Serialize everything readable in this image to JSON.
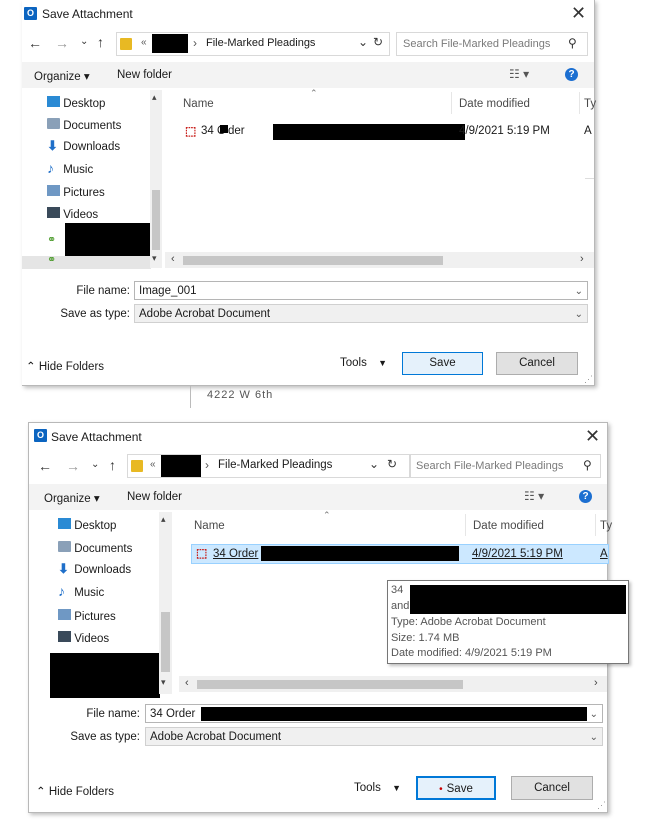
{
  "dialog1": {
    "title": "Save Attachment",
    "address": {
      "chevron": "«",
      "separator": "›",
      "folder": "File-Marked Pleadings"
    },
    "search_placeholder": "Search File-Marked Pleadings",
    "toolbar": {
      "organize": "Organize ▾",
      "new_folder": "New folder",
      "help": "?"
    },
    "sidebar": [
      {
        "label": "Desktop",
        "icon": "desktop-icon"
      },
      {
        "label": "Documents",
        "icon": "documents-icon"
      },
      {
        "label": "Downloads",
        "icon": "downloads-icon"
      },
      {
        "label": "Music",
        "icon": "music-icon"
      },
      {
        "label": "Pictures",
        "icon": "pictures-icon"
      },
      {
        "label": "Videos",
        "icon": "videos-icon"
      }
    ],
    "columns": {
      "name": "Name",
      "date": "Date modified",
      "type": "Ty"
    },
    "row": {
      "name_prefix": "34 O",
      "name_mid": "der",
      "date": "4/9/2021 5:19 PM",
      "type": "A"
    },
    "file_name_label": "File name:",
    "file_name_value": "Image_001",
    "save_type_label": "Save as type:",
    "save_type_value": "Adobe Acrobat Document",
    "hide_folders": "Hide Folders",
    "tools": "Tools",
    "save": "Save",
    "cancel": "Cancel"
  },
  "between_text": {
    "line1": "4222 W 6th"
  },
  "dialog2": {
    "title": "Save Attachment",
    "address": {
      "chevron": "«",
      "separator": "›",
      "folder": "File-Marked Pleadings"
    },
    "search_placeholder": "Search File-Marked Pleadings",
    "toolbar": {
      "organize": "Organize ▾",
      "new_folder": "New folder",
      "help": "?"
    },
    "sidebar": [
      {
        "label": "Desktop",
        "icon": "desktop-icon"
      },
      {
        "label": "Documents",
        "icon": "documents-icon"
      },
      {
        "label": "Downloads",
        "icon": "downloads-icon"
      },
      {
        "label": "Music",
        "icon": "music-icon"
      },
      {
        "label": "Pictures",
        "icon": "pictures-icon"
      },
      {
        "label": "Videos",
        "icon": "videos-icon"
      }
    ],
    "columns": {
      "name": "Name",
      "date": "Date modified",
      "type": "Ty"
    },
    "row": {
      "name_prefix": "34 Order",
      "date": "4/9/2021 5:19 PM",
      "type": "A"
    },
    "tooltip": {
      "line1": "34",
      "line2": "and",
      "type": "Type: Adobe Acrobat Document",
      "size": "Size: 1.74 MB",
      "date": "Date modified: 4/9/2021 5:19 PM"
    },
    "file_name_label": "File name:",
    "file_name_value": "34 Order",
    "save_type_label": "Save as type:",
    "save_type_value": "Adobe Acrobat Document",
    "hide_folders": "Hide Folders",
    "tools": "Tools",
    "save": "Save",
    "cancel": "Cancel"
  }
}
